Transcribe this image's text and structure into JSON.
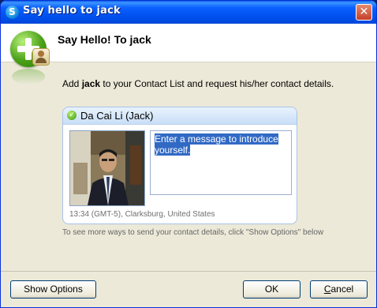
{
  "window": {
    "title": "Say hello to jack",
    "close_label": "✕"
  },
  "header": {
    "title": "Say Hello! To jack"
  },
  "intro": {
    "prefix": "Add ",
    "name": "jack",
    "suffix": " to your Contact List and request his/her contact details."
  },
  "contact_card": {
    "display_name": "Da Cai Li (Jack)",
    "status_icon": "online-check-icon",
    "message_selected": "Enter a message to introduce yourself.",
    "local_time_location": "13:34 (GMT-5), Clarksburg, United States"
  },
  "hint": "To see more ways to send your contact details, click \"Show Options\" below",
  "buttons": {
    "show_options": "Show Options",
    "ok": "OK",
    "cancel_prefix": "",
    "cancel_accel": "C",
    "cancel_suffix": "ancel"
  },
  "colors": {
    "titlebar": "#0050ee",
    "card_header": "#c9def7",
    "selection": "#316ac5"
  }
}
